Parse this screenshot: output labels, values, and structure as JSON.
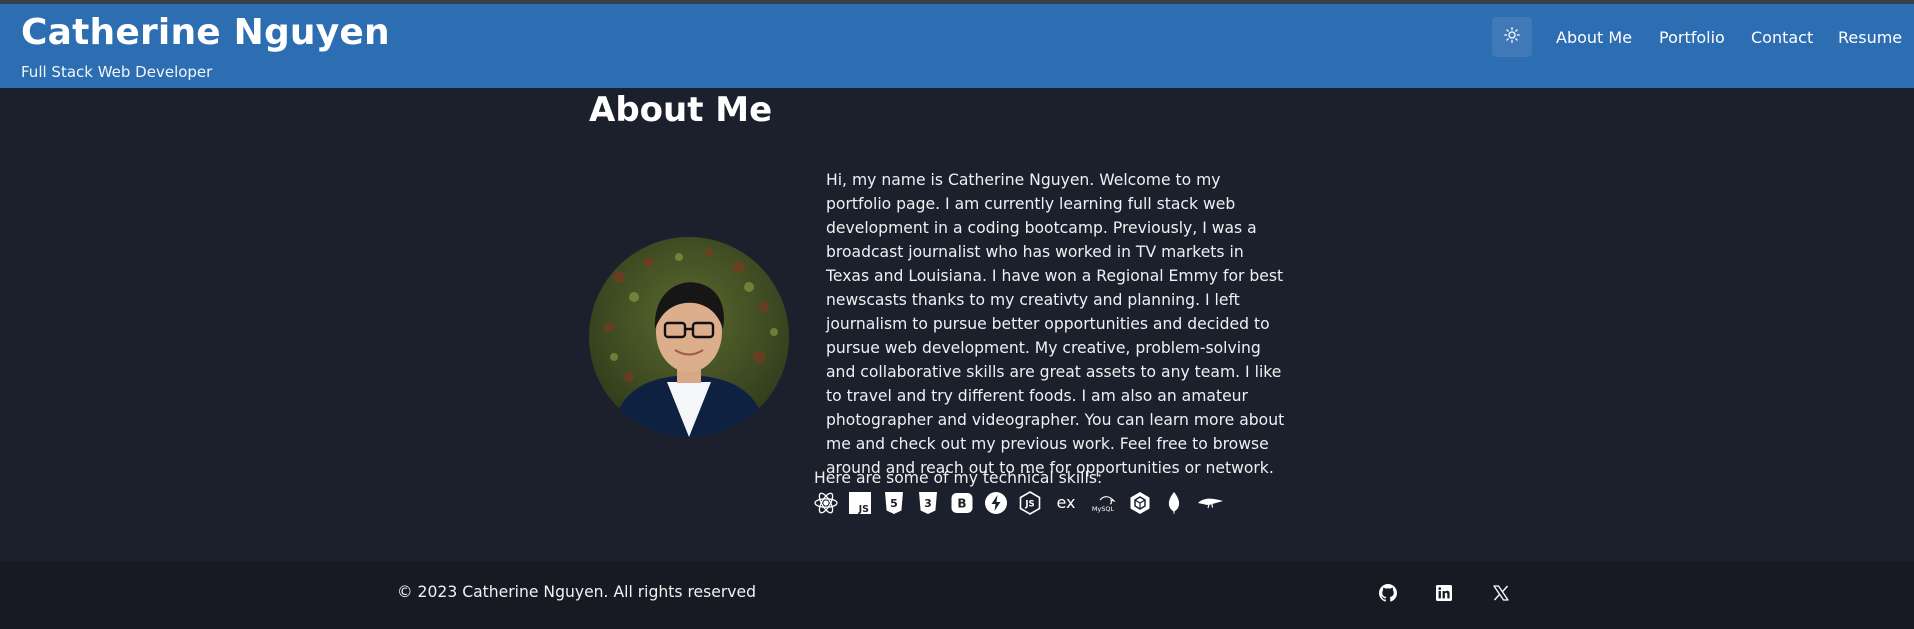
{
  "header": {
    "name": "Catherine Nguyen",
    "subtitle": "Full Stack Web Developer",
    "theme_toggle_icon": "sun-icon",
    "nav": [
      {
        "label": "About Me"
      },
      {
        "label": "Portfolio"
      },
      {
        "label": "Contact"
      },
      {
        "label": "Resume"
      }
    ]
  },
  "about": {
    "title": "About Me",
    "bio": "Hi, my name is Catherine Nguyen. Welcome to my portfolio page. I am currently learning full stack web development in a coding bootcamp. Previously, I was a broadcast journalist who has worked in TV markets in Texas and Louisiana. I have won a Regional Emmy for best newscasts thanks to my creativty and planning. I left journalism to pursue better opportunities and decided to pursue web development. My creative, problem-solving and collaborative skills are great assets to any team. I like to travel and try different foods. I am also an amateur photographer and videographer. You can learn more about me and check out my previous work. Feel free to browse around and reach out to me for opportunities or network.",
    "skills_label": "Here are some of my technical skills:",
    "skills": [
      {
        "icon": "react-icon"
      },
      {
        "icon": "javascript-icon",
        "text": "JS"
      },
      {
        "icon": "html5-icon",
        "text": "5"
      },
      {
        "icon": "css3-icon",
        "text": "3"
      },
      {
        "icon": "bootstrap-icon",
        "text": "B"
      },
      {
        "icon": "bolt-icon"
      },
      {
        "icon": "nodejs-icon",
        "text": "JS"
      },
      {
        "icon": "express-icon",
        "text": "ex"
      },
      {
        "icon": "mysql-icon",
        "text": "MySQL"
      },
      {
        "icon": "sequelize-icon"
      },
      {
        "icon": "mongodb-icon"
      },
      {
        "icon": "mongoose-icon"
      }
    ]
  },
  "footer": {
    "copyright": "© 2023 Catherine Nguyen. All rights reserved",
    "social": [
      {
        "icon": "github-icon"
      },
      {
        "icon": "linkedin-icon"
      },
      {
        "icon": "x-twitter-icon"
      }
    ]
  },
  "colors": {
    "header_bg": "#2d6db1",
    "page_bg": "#1b202c",
    "footer_bg": "#171a22",
    "text": "#f1f1f1"
  }
}
